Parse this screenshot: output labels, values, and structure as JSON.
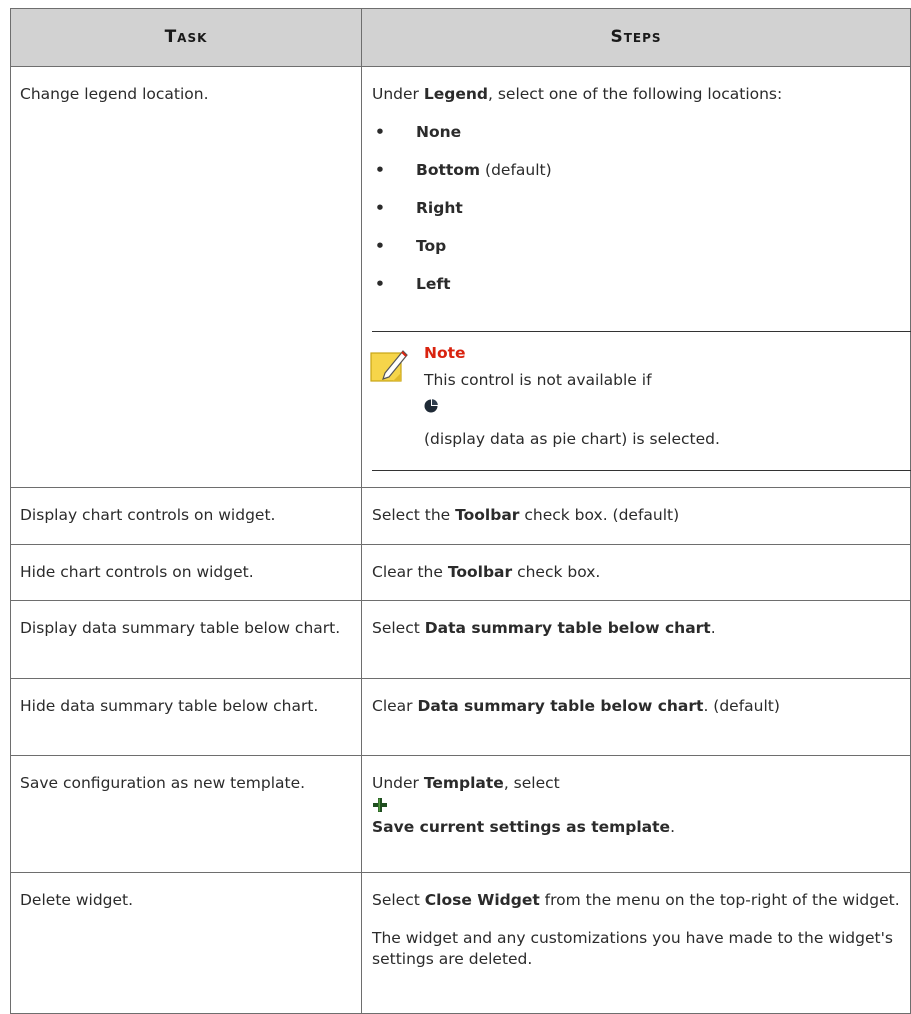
{
  "header": {
    "task": "Task",
    "steps": "Steps"
  },
  "rows": [
    {
      "task": "Change legend location.",
      "intro_prefix": "Under ",
      "intro_bold": "Legend",
      "intro_suffix": ", select one of the following locations:",
      "locations": [
        {
          "label": "None",
          "suffix": ""
        },
        {
          "label": "Bottom",
          "suffix": " (default)"
        },
        {
          "label": "Right",
          "suffix": ""
        },
        {
          "label": "Top",
          "suffix": ""
        },
        {
          "label": "Left",
          "suffix": ""
        }
      ],
      "bullet": "•",
      "note": {
        "title": "Note",
        "line1": "This control is not available if",
        "line2": "(display data as pie chart) is selected.",
        "icon": "note-pencil-icon",
        "inline_icon": "pie-chart-icon"
      }
    },
    {
      "task": "Display chart controls on widget.",
      "pre": "Select the ",
      "bold": "Toolbar",
      "post": " check box. (default)"
    },
    {
      "task": "Hide chart controls on widget.",
      "pre": "Clear the ",
      "bold": "Toolbar",
      "post": " check box."
    },
    {
      "task": "Display data summary table below chart.",
      "pre": "Select ",
      "bold": "Data summary table below chart",
      "post": "."
    },
    {
      "task": "Hide data summary table below chart.",
      "pre": "Clear ",
      "bold": "Data summary table below chart",
      "post": ". (default)"
    },
    {
      "task": "Save configuration as new template.",
      "pre": "Under ",
      "bold": "Template",
      "post": ", select",
      "icon": "plus-icon",
      "bold2": "Save current settings as template",
      "post2": "."
    },
    {
      "task": "Delete widget.",
      "pre": "Select ",
      "bold": "Close Widget",
      "post": " from the menu on the top-right of the widget.",
      "para2": "The widget and any customizations you have made to the widget's settings are deleted."
    }
  ],
  "colors": {
    "header_bg": "#d2d2d2",
    "note_title": "#d9230f",
    "border": "#6e6e6e"
  }
}
